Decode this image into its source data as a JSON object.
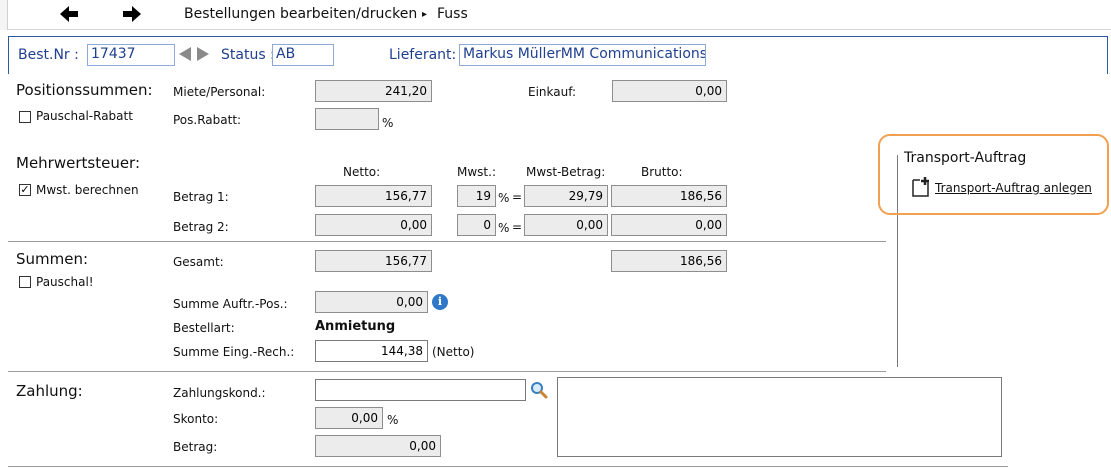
{
  "toolbar": {
    "breadcrumb": [
      "Bestellungen bearbeiten/drucken",
      "Fuss"
    ],
    "breadcrumb_separator": "▸"
  },
  "header": {
    "best_nr_label": "Best.Nr :",
    "best_nr_value": "17437",
    "status_label": "Status :",
    "status_value": "AB",
    "lieferant_label": "Lieferant:",
    "lieferant_value": "Markus MüllerMM Communications"
  },
  "positionssummen": {
    "title": "Positionssummen:",
    "pauschal_rabatt_label": "Pauschal-Rabatt",
    "pauschal_rabatt_checked": false,
    "miete_label": "Miete/Personal:",
    "miete_value": "241,20",
    "einkauf_label": "Einkauf:",
    "einkauf_value": "0,00",
    "pos_rabatt_label": "Pos.Rabatt:",
    "pos_rabatt_value": "",
    "pos_rabatt_unit": "%"
  },
  "mwst": {
    "title": "Mehrwertsteuer:",
    "berechnen_label": "Mwst. berechnen",
    "berechnen_checked": true,
    "col_netto": "Netto:",
    "col_mwst": "Mwst.:",
    "col_mwst_betrag": "Mwst-Betrag:",
    "col_brutto": "Brutto:",
    "percent_sign": "%",
    "equals_sign": "=",
    "rows": [
      {
        "label": "Betrag 1:",
        "netto": "156,77",
        "mwst": "19",
        "mwst_betrag": "29,79",
        "brutto": "186,56"
      },
      {
        "label": "Betrag 2:",
        "netto": "0,00",
        "mwst": "0",
        "mwst_betrag": "0,00",
        "brutto": "0,00"
      }
    ]
  },
  "summen": {
    "title": "Summen:",
    "pauschal_label": "Pauschal!",
    "pauschal_checked": false,
    "gesamt_label": "Gesamt:",
    "gesamt_netto": "156,77",
    "gesamt_brutto": "186,56",
    "summe_auftr_label": "Summe Auftr.-Pos.:",
    "summe_auftr_value": "0,00",
    "bestellart_label": "Bestellart:",
    "bestellart_value": "Anmietung",
    "summe_eing_label": "Summe Eing.-Rech.:",
    "summe_eing_value": "144,38",
    "summe_eing_suffix": "(Netto)"
  },
  "zahlung": {
    "title": "Zahlung:",
    "kond_label": "Zahlungskond.:",
    "kond_value": "",
    "skonto_label": "Skonto:",
    "skonto_value": "0,00",
    "skonto_unit": "%",
    "betrag_label": "Betrag:",
    "betrag_value": "0,00",
    "memo_value": ""
  },
  "transport": {
    "title": "Transport-Auftrag",
    "link_label": "Transport-Auftrag anlegen"
  },
  "icons": {
    "back": "arrow-left-icon",
    "forward": "arrow-right-icon",
    "prev_next": "triangle-prev-next-icon",
    "info": "info-icon",
    "search": "magnifier-icon",
    "new_document": "new-document-icon"
  },
  "colors": {
    "accent_blue": "#1f3f8f",
    "highlight_orange": "#f0a050",
    "readonly_bg": "#ececec"
  }
}
